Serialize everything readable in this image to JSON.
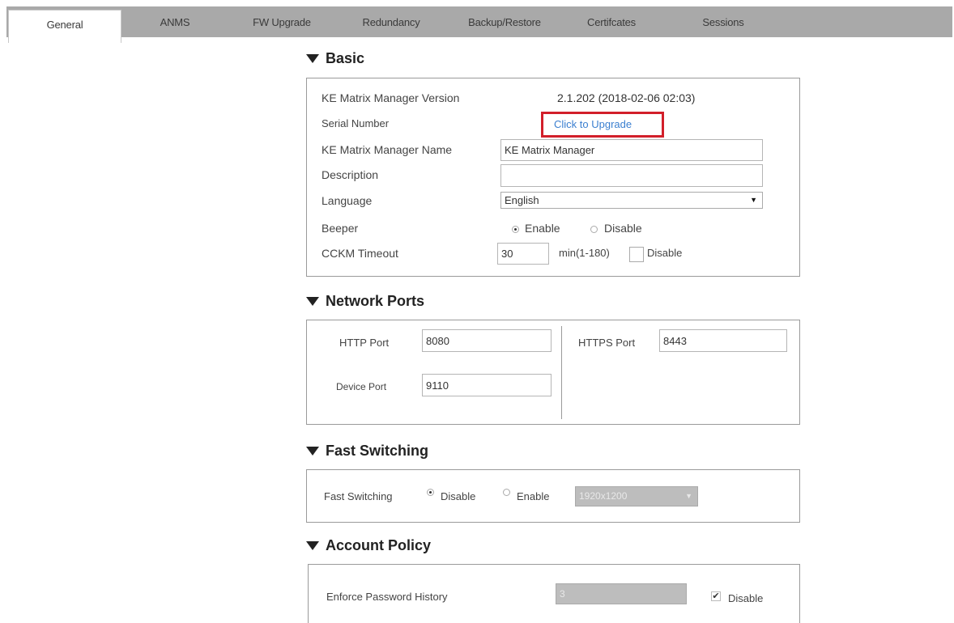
{
  "tabs": [
    {
      "label": "General",
      "active": true
    },
    {
      "label": "ANMS"
    },
    {
      "label": "FW Upgrade"
    },
    {
      "label": "Redundancy"
    },
    {
      "label": "Backup/Restore"
    },
    {
      "label": "Certifcates"
    },
    {
      "label": "Sessions"
    }
  ],
  "basic": {
    "heading": "Basic",
    "version_label": "KE Matrix Manager Version",
    "version_value": "2.1.202 (2018-02-06 02:03)",
    "serial_label": "Serial Number",
    "serial_link": "Click to Upgrade",
    "name_label": "KE Matrix Manager Name",
    "name_value": "KE Matrix Manager",
    "description_label": "Description",
    "description_value": "",
    "language_label": "Language",
    "language_value": "English",
    "beeper_label": "Beeper",
    "beeper_enable": "Enable",
    "beeper_disable": "Disable",
    "beeper_selected": "Enable",
    "ccm_label": "CCKM Timeout",
    "ccm_value": "30",
    "ccm_unit": "min(1-180)",
    "ccm_disable": "Disable"
  },
  "network_ports": {
    "heading": "Network Ports",
    "http_label": "HTTP Port",
    "http_value": "8080",
    "https_label": "HTTPS Port",
    "https_value": "8443",
    "device_label": "Device Port",
    "device_value": "9110"
  },
  "fast_switching": {
    "heading": "Fast Switching",
    "label": "Fast Switching",
    "disable": "Disable",
    "enable": "Enable",
    "selected": "Disable",
    "resolution_value": "1920x1200"
  },
  "account_policy": {
    "heading": "Account Policy",
    "history_label": "Enforce Password History",
    "history_value": "3",
    "history_disable": "Disable",
    "history_disable_checked": true
  },
  "colors": {
    "tabbar": "#a9a9a9",
    "link": "#3b7fd0",
    "highlight": "#d21f2a"
  }
}
